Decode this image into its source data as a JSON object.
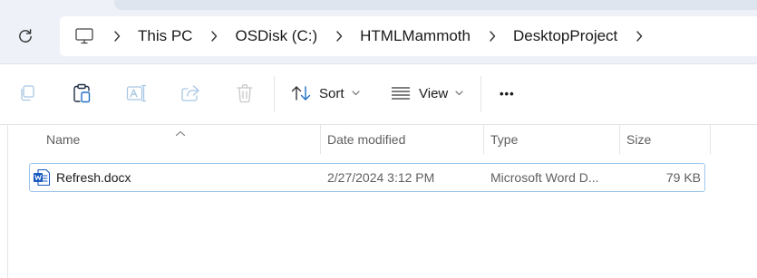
{
  "address_bar": {
    "crumbs": [
      "This PC",
      "OSDisk (C:)",
      "HTMLMammoth",
      "DesktopProject"
    ]
  },
  "toolbar": {
    "sort_label": "Sort",
    "view_label": "View",
    "more_label": "•••"
  },
  "columns": {
    "name": "Name",
    "date_modified": "Date modified",
    "type": "Type",
    "size": "Size"
  },
  "files": [
    {
      "name": "Refresh.docx",
      "date_modified": "2/27/2024 3:12 PM",
      "type": "Microsoft Word D...",
      "size": "79 KB",
      "icon": "word-document-icon"
    }
  ],
  "colors": {
    "selection_border": "#9fc7ea",
    "word_blue": "#185abd",
    "chrome_background": "#eef2f8"
  }
}
